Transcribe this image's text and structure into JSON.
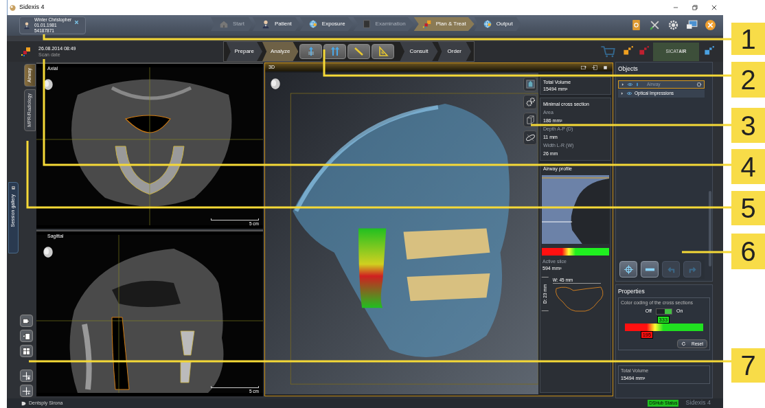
{
  "window": {
    "title": "Sidexis 4"
  },
  "patient": {
    "name": "Winter Christopher",
    "birth_date": "01.01.1981",
    "id": "54187871"
  },
  "workflow_tabs": [
    {
      "label": "Start",
      "selected": false,
      "disabled": true
    },
    {
      "label": "Patient",
      "selected": false,
      "disabled": false
    },
    {
      "label": "Exposure",
      "selected": false,
      "disabled": false
    },
    {
      "label": "Examination",
      "selected": false,
      "disabled": true
    },
    {
      "label": "Plan & Treat",
      "selected": true,
      "disabled": false
    },
    {
      "label": "Output",
      "selected": false,
      "disabled": false
    }
  ],
  "scan": {
    "date": "26.08.2014 08:49",
    "label": "Scan date"
  },
  "steps": [
    {
      "label": "Prepare",
      "selected": false
    },
    {
      "label": "Analyze",
      "selected": true
    }
  ],
  "steps_after": [
    {
      "label": "Consult"
    },
    {
      "label": "Order"
    }
  ],
  "plugin": {
    "label": "SICAT**AIR**"
  },
  "view_tabs": [
    {
      "label": "Airway",
      "selected": true
    },
    {
      "label": "MPR/Radiology",
      "selected": false
    }
  ],
  "session_gallery": {
    "label": "Session gallery"
  },
  "axial": {
    "title": "Axial",
    "scale": "5 cm"
  },
  "sagittal": {
    "title": "Sagittal",
    "scale": "5 cm"
  },
  "view_3d": {
    "title": "3D"
  },
  "info": {
    "total_volume_label": "Total Volume",
    "total_volume": "15494 mm³",
    "cross_section_title": "Minimal cross section",
    "area_label": "Area",
    "area": "186 mm²",
    "depth_label": "Depth A-P (D)",
    "depth": "11 mm",
    "width_label": "Width L-R (W)",
    "width": "26 mm",
    "profile_title": "Airway profile",
    "active_slice_label": "Active slice",
    "active_slice": "594 mm²",
    "w_dim": "W: 45 mm",
    "d_dim": "D: 23 mm"
  },
  "objects": {
    "title": "Objects",
    "items": [
      {
        "label": "Airway",
        "selected": true
      },
      {
        "label": "Optical Impressions",
        "selected": false
      }
    ]
  },
  "properties": {
    "title": "Properties",
    "color_coding": "Color coding of the cross sections",
    "off": "Off",
    "on": "On",
    "toggle_on": true,
    "markers": [
      {
        "value": "333",
        "level": 0.49,
        "kind": "upper"
      },
      {
        "value": "195",
        "level": 0.28,
        "kind": "lower"
      }
    ],
    "reset": "Reset",
    "total_volume_label": "Total Volume",
    "total_volume": "15494 mm³"
  },
  "status": {
    "brand": "Dentsply Sirona",
    "dshub": "DSHub Status",
    "product": "Sidexis 4"
  },
  "callouts": [
    "1",
    "2",
    "3",
    "4",
    "5",
    "6",
    "7"
  ]
}
